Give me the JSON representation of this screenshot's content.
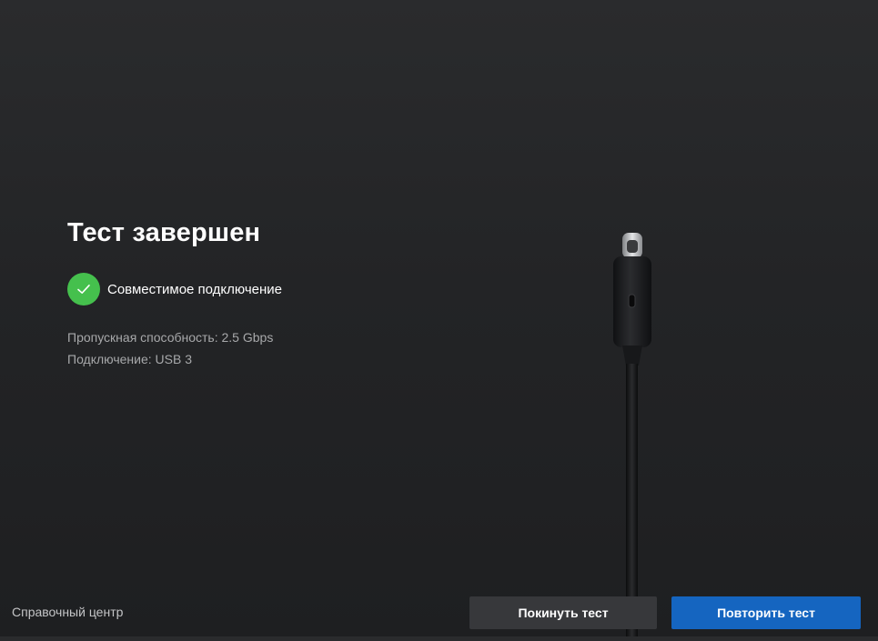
{
  "main": {
    "title": "Тест завершен",
    "status": {
      "icon": "checkmark-icon",
      "color": "#45c04d",
      "text": "Совместимое подключение"
    },
    "bandwidth_text": "Пропускная способность: 2.5 Gbps",
    "connection_text": "Подключение: USB 3",
    "illustration": "usb-c-cable"
  },
  "footer": {
    "help_link": "Справочный центр",
    "leave_button": "Покинуть тест",
    "retry_button": "Повторить тест"
  },
  "colors": {
    "background": "#252628",
    "success": "#45c04d",
    "primary_button": "#1565c0",
    "secondary_button": "#37383b"
  }
}
